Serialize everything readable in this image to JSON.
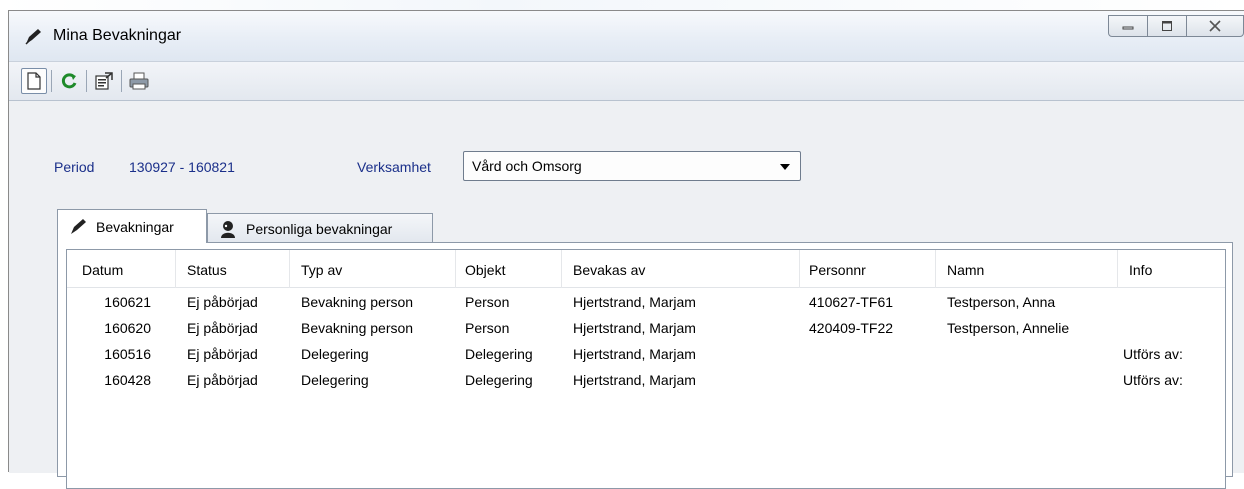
{
  "window": {
    "title": "Mina Bevakningar",
    "controls": {
      "minimize_icon": "minimize-icon",
      "maximize_icon": "maximize-icon",
      "close_icon": "close-icon"
    }
  },
  "toolbar": {
    "buttons": [
      {
        "name": "new-button",
        "icon": "new-document-icon"
      },
      {
        "name": "refresh-button",
        "icon": "refresh-icon"
      },
      {
        "name": "properties-button",
        "icon": "properties-icon"
      },
      {
        "name": "print-button",
        "icon": "printer-icon"
      }
    ]
  },
  "filters": {
    "period_label": "Period",
    "period_value": "130927 - 160821",
    "verksamhet_label": "Verksamhet",
    "verksamhet_value": "Vård och Omsorg"
  },
  "tabs": [
    {
      "label": "Bevakningar",
      "active": true,
      "icon": "pen-icon"
    },
    {
      "label": "Personliga bevakningar",
      "active": false,
      "icon": "person-icon"
    }
  ],
  "table": {
    "columns": [
      "Datum",
      "Status",
      "Typ av",
      "Objekt",
      "Bevakas av",
      "Personnr",
      "Namn",
      "Info"
    ],
    "rows": [
      [
        "160621",
        "Ej påbörjad",
        "Bevakning person",
        "Person",
        "Hjertstrand, Marjam",
        "410627-TF61",
        "Testperson, Anna",
        ""
      ],
      [
        "160620",
        "Ej påbörjad",
        "Bevakning person",
        "Person",
        "Hjertstrand, Marjam",
        "420409-TF22",
        "Testperson, Annelie",
        ""
      ],
      [
        "160516",
        "Ej påbörjad",
        "Delegering",
        "Delegering",
        "Hjertstrand, Marjam",
        "",
        "",
        "Utförs av:"
      ],
      [
        "160428",
        "Ej påbörjad",
        "Delegering",
        "Delegering",
        "Hjertstrand, Marjam",
        "",
        "",
        "Utförs av:"
      ]
    ]
  },
  "colors": {
    "label_blue": "#1a2f8a",
    "refresh_green": "#1e8a2a"
  }
}
